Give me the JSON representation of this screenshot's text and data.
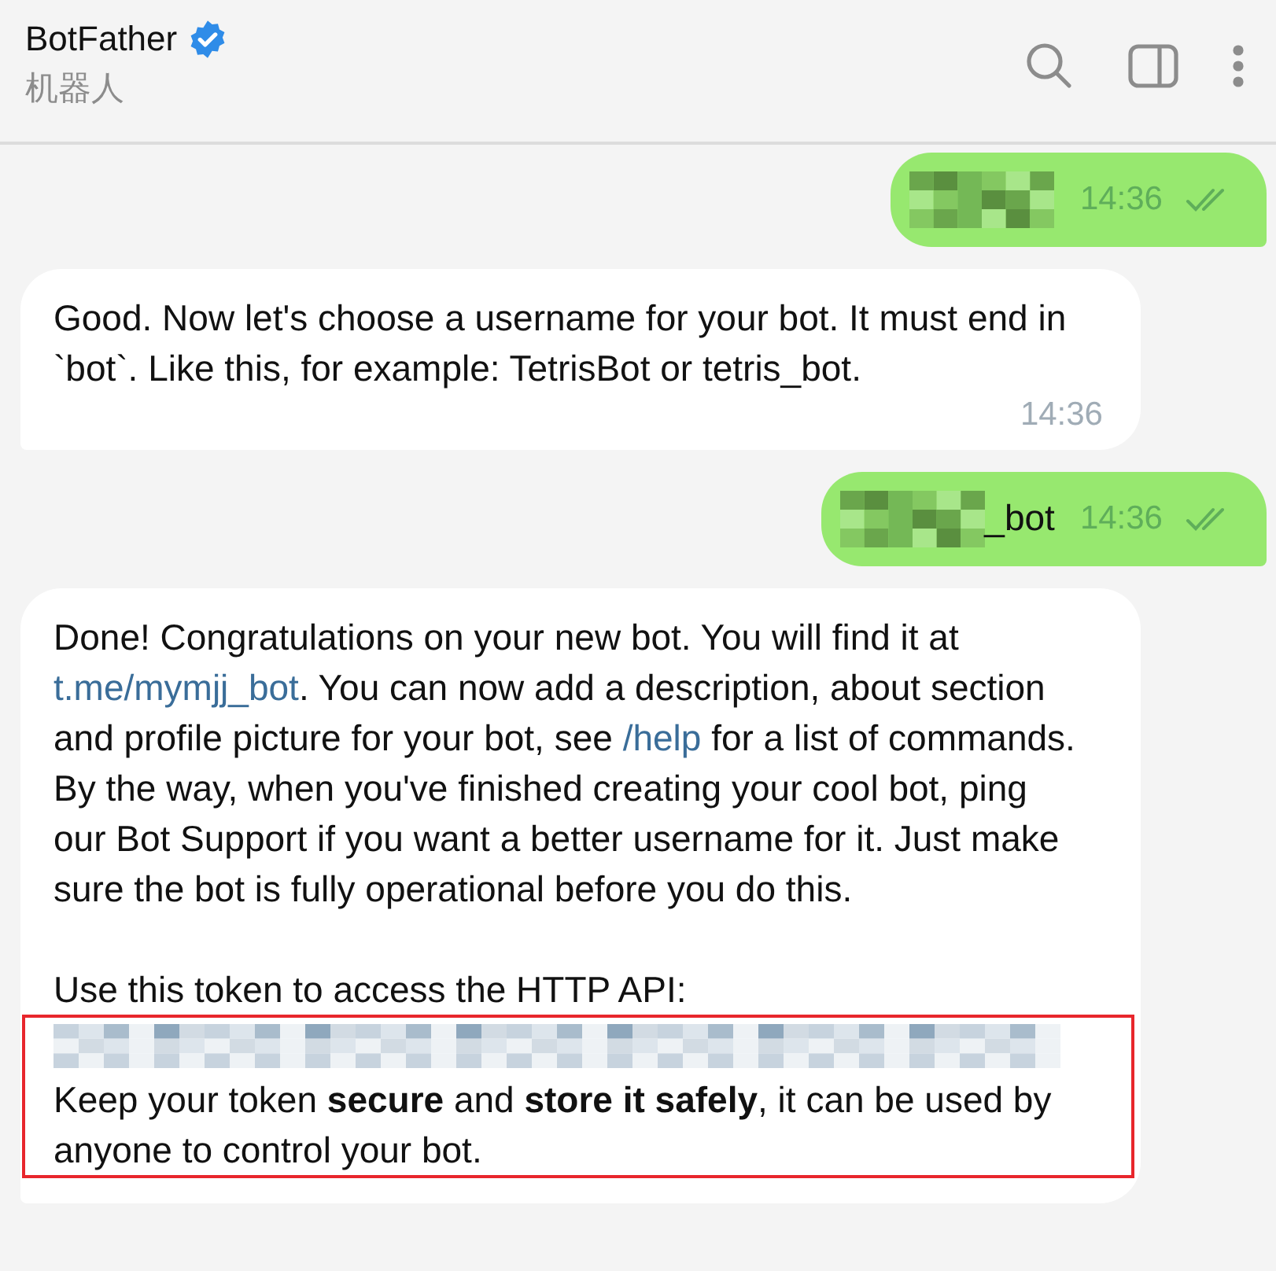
{
  "header": {
    "title": "BotFather",
    "verified": true,
    "subtitle": "机器人"
  },
  "messages": [
    {
      "kind": "outgoing",
      "redacted": true,
      "time": "14:36",
      "read": true
    },
    {
      "kind": "incoming",
      "blocks": [
        {
          "kind": "text",
          "highlighted": false,
          "segments": [
            {
              "text": "Good. Now let's choose a username for your bot. It must end in `bot`. Like this, for example: TetrisBot or tetris_bot."
            }
          ]
        }
      ],
      "time": "14:36"
    },
    {
      "kind": "outgoing",
      "redacted": true,
      "suffix": "_bot",
      "time": "14:36",
      "read": true
    },
    {
      "kind": "incoming",
      "blocks": [
        {
          "kind": "text",
          "highlighted": false,
          "segments": [
            {
              "text": "Done! Congratulations on your new bot. You will find it at "
            },
            {
              "link": "t.me/mymjj_bot"
            },
            {
              "text": ". You can now add a description, about section and profile picture for your bot, see "
            },
            {
              "link": "/help"
            },
            {
              "text": " for a list of commands. By the way, when you've finished creating your cool bot, ping our Bot Support if you want a better username for it. Just make sure the bot is fully operational before you do this."
            }
          ]
        },
        {
          "kind": "text",
          "highlighted": false,
          "segments": [
            {
              "text": "Use this token to access the HTTP API:"
            }
          ]
        },
        {
          "kind": "redacted",
          "highlighted": true
        },
        {
          "kind": "text",
          "highlighted": true,
          "segments": [
            {
              "text": "Keep your token **secure** and **store it safely**, it can be used by anyone to control your bot."
            }
          ]
        }
      ]
    }
  ]
}
